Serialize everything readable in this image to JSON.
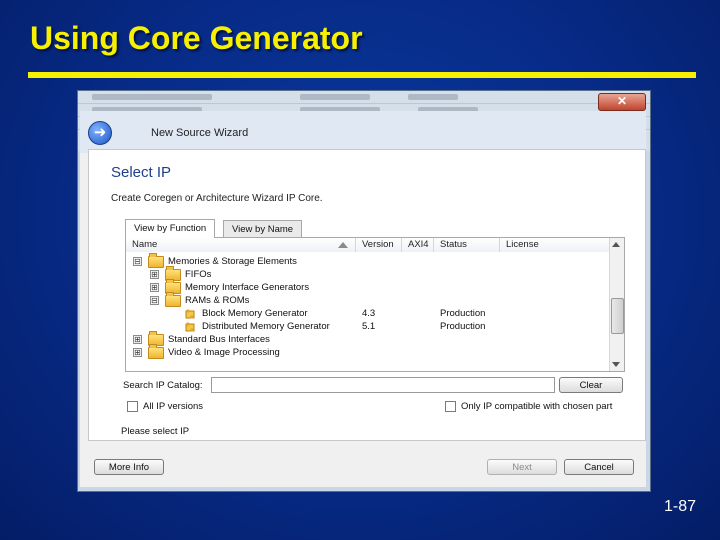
{
  "slide": {
    "title": "Using Core Generator",
    "page": "1-87"
  },
  "window": {
    "close_glyph": "✕"
  },
  "wizard": {
    "title": "New Source Wizard",
    "heading": "Select IP",
    "subtitle": "Create Coregen or Architecture Wizard IP Core.",
    "tabs": [
      {
        "label": "View by Function"
      },
      {
        "label": "View by Name"
      }
    ],
    "columns": [
      "Name",
      "Version",
      "AXI4",
      "Status",
      "License"
    ],
    "tree": [
      {
        "expander": "⊟",
        "name": "Memories & Storage Elements",
        "version": "",
        "status": ""
      },
      {
        "expander": "⊞",
        "name": "FIFOs",
        "version": "",
        "status": ""
      },
      {
        "expander": "⊞",
        "name": "Memory Interface Generators",
        "version": "",
        "status": ""
      },
      {
        "expander": "⊟",
        "name": "RAMs & ROMs",
        "version": "",
        "status": ""
      },
      {
        "expander": "",
        "name": "Block Memory Generator",
        "version": "4.3",
        "status": "Production"
      },
      {
        "expander": "",
        "name": "Distributed Memory Generator",
        "version": "5.1",
        "status": "Production"
      },
      {
        "expander": "⊞",
        "name": "Standard Bus Interfaces",
        "version": "",
        "status": ""
      },
      {
        "expander": "⊞",
        "name": "Video & Image Processing",
        "version": "",
        "status": ""
      }
    ],
    "search_label": "Search IP Catalog:",
    "search_value": "",
    "clear_label": "Clear",
    "all_versions_label": "All IP versions",
    "compatible_label": "Only IP compatible with chosen part",
    "status_text": "Please select IP",
    "more_info_label": "More Info",
    "next_label": "Next",
    "cancel_label": "Cancel"
  },
  "colors": {
    "slide_bg": "#072a86",
    "title": "#f7f000",
    "heading": "#1e3f8a"
  }
}
